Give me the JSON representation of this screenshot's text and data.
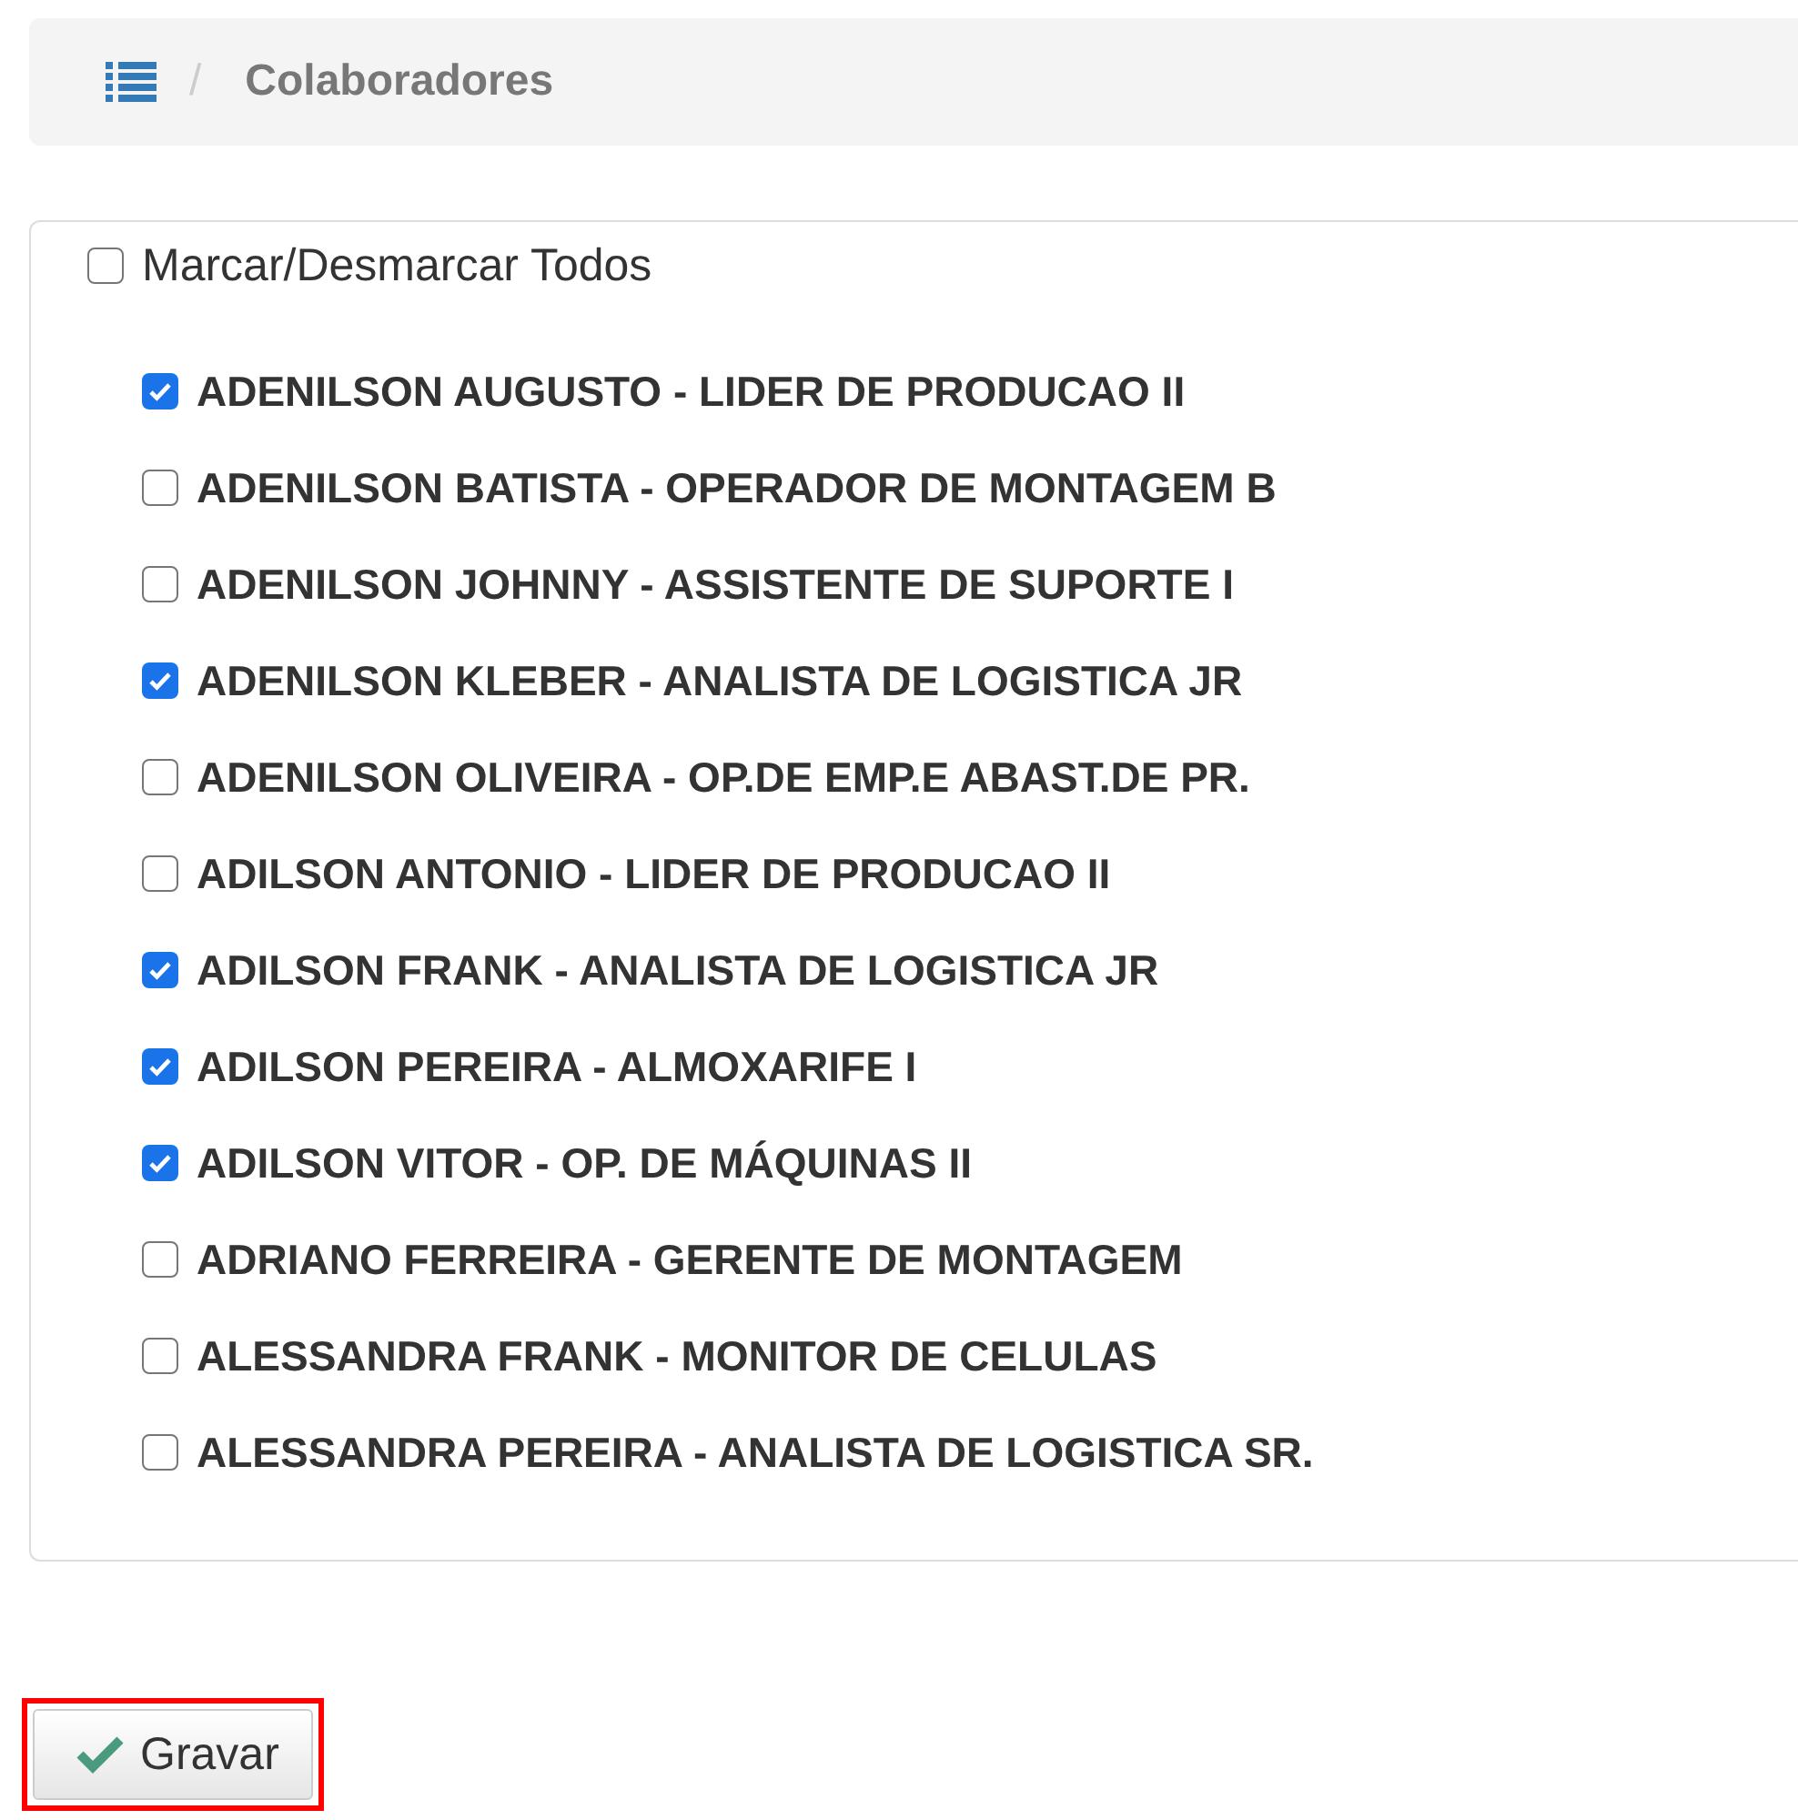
{
  "breadcrumb": {
    "separator": "/",
    "current": "Colaboradores"
  },
  "select_all": {
    "label": "Marcar/Desmarcar Todos",
    "checked": false
  },
  "employees": [
    {
      "label": "ADENILSON AUGUSTO - LIDER DE PRODUCAO II",
      "checked": true
    },
    {
      "label": "ADENILSON BATISTA - OPERADOR DE MONTAGEM B",
      "checked": false
    },
    {
      "label": "ADENILSON JOHNNY - ASSISTENTE DE SUPORTE I",
      "checked": false
    },
    {
      "label": "ADENILSON KLEBER - ANALISTA DE LOGISTICA JR",
      "checked": true
    },
    {
      "label": "ADENILSON OLIVEIRA - OP.DE EMP.E ABAST.DE PR.",
      "checked": false
    },
    {
      "label": "ADILSON ANTONIO - LIDER DE PRODUCAO II",
      "checked": false
    },
    {
      "label": "ADILSON FRANK - ANALISTA DE LOGISTICA JR",
      "checked": true
    },
    {
      "label": "ADILSON PEREIRA - ALMOXARIFE I",
      "checked": true
    },
    {
      "label": "ADILSON VITOR - OP. DE MÁQUINAS II",
      "checked": true
    },
    {
      "label": "ADRIANO FERREIRA - GERENTE DE MONTAGEM",
      "checked": false
    },
    {
      "label": "ALESSANDRA FRANK - MONITOR DE CELULAS",
      "checked": false
    },
    {
      "label": "ALESSANDRA PEREIRA - ANALISTA DE LOGISTICA SR.",
      "checked": false
    }
  ],
  "save_button": {
    "label": "Gravar",
    "highlighted": true
  }
}
